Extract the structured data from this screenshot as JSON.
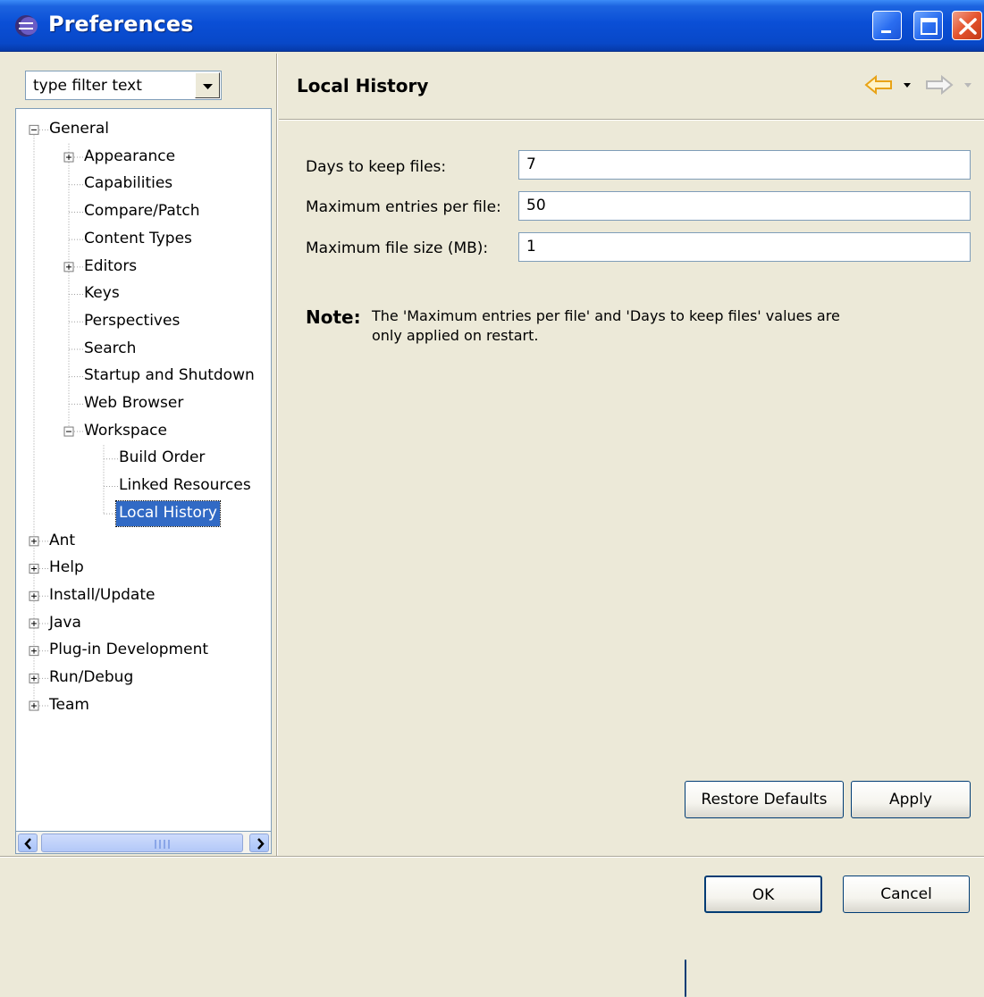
{
  "window": {
    "title": "Preferences",
    "icon": "eclipse-icon",
    "controls": [
      "minimize-icon",
      "maximize-icon",
      "close-icon"
    ]
  },
  "filter": {
    "value": "type filter text"
  },
  "tree": {
    "items": [
      {
        "label": "General",
        "expander": "minus",
        "level": 0
      },
      {
        "label": "Appearance",
        "expander": "plus",
        "level": 1
      },
      {
        "label": "Capabilities",
        "expander": "none",
        "level": 1
      },
      {
        "label": "Compare/Patch",
        "expander": "none",
        "level": 1
      },
      {
        "label": "Content Types",
        "expander": "none",
        "level": 1
      },
      {
        "label": "Editors",
        "expander": "plus",
        "level": 1
      },
      {
        "label": "Keys",
        "expander": "none",
        "level": 1
      },
      {
        "label": "Perspectives",
        "expander": "none",
        "level": 1
      },
      {
        "label": "Search",
        "expander": "none",
        "level": 1
      },
      {
        "label": "Startup and Shutdown",
        "expander": "none",
        "level": 1
      },
      {
        "label": "Web Browser",
        "expander": "none",
        "level": 1
      },
      {
        "label": "Workspace",
        "expander": "minus",
        "level": 1
      },
      {
        "label": "Build Order",
        "expander": "none",
        "level": 2
      },
      {
        "label": "Linked Resources",
        "expander": "none",
        "level": 2
      },
      {
        "label": "Local History",
        "expander": "none",
        "level": 2,
        "selected": true
      },
      {
        "label": "Ant",
        "expander": "plus",
        "level": 0
      },
      {
        "label": "Help",
        "expander": "plus",
        "level": 0
      },
      {
        "label": "Install/Update",
        "expander": "plus",
        "level": 0
      },
      {
        "label": "Java",
        "expander": "plus",
        "level": 0
      },
      {
        "label": "Plug-in Development",
        "expander": "plus",
        "level": 0
      },
      {
        "label": "Run/Debug",
        "expander": "plus",
        "level": 0
      },
      {
        "label": "Team",
        "expander": "plus",
        "level": 0
      }
    ]
  },
  "page": {
    "title": "Local History",
    "nav_icons": [
      "back-arrow-icon",
      "dropdown-icon",
      "forward-arrow-icon",
      "dropdown-icon"
    ],
    "fields": [
      {
        "label": "Days to keep files:",
        "value": "7"
      },
      {
        "label": "Maximum entries per file:",
        "value": "50"
      },
      {
        "label": "Maximum file size (MB):",
        "value": "1"
      }
    ],
    "note_label": "Note:",
    "note_text": "The 'Maximum entries per file' and 'Days to keep files' values are only applied on restart."
  },
  "buttons": {
    "restore_defaults": "Restore Defaults",
    "apply": "Apply",
    "ok": "OK",
    "cancel": "Cancel"
  },
  "colors": {
    "titlebar": "#0a4fd6",
    "selection": "#316ac5",
    "dialog_bg": "#ece9d8",
    "back_arrow": "#e8a317"
  }
}
